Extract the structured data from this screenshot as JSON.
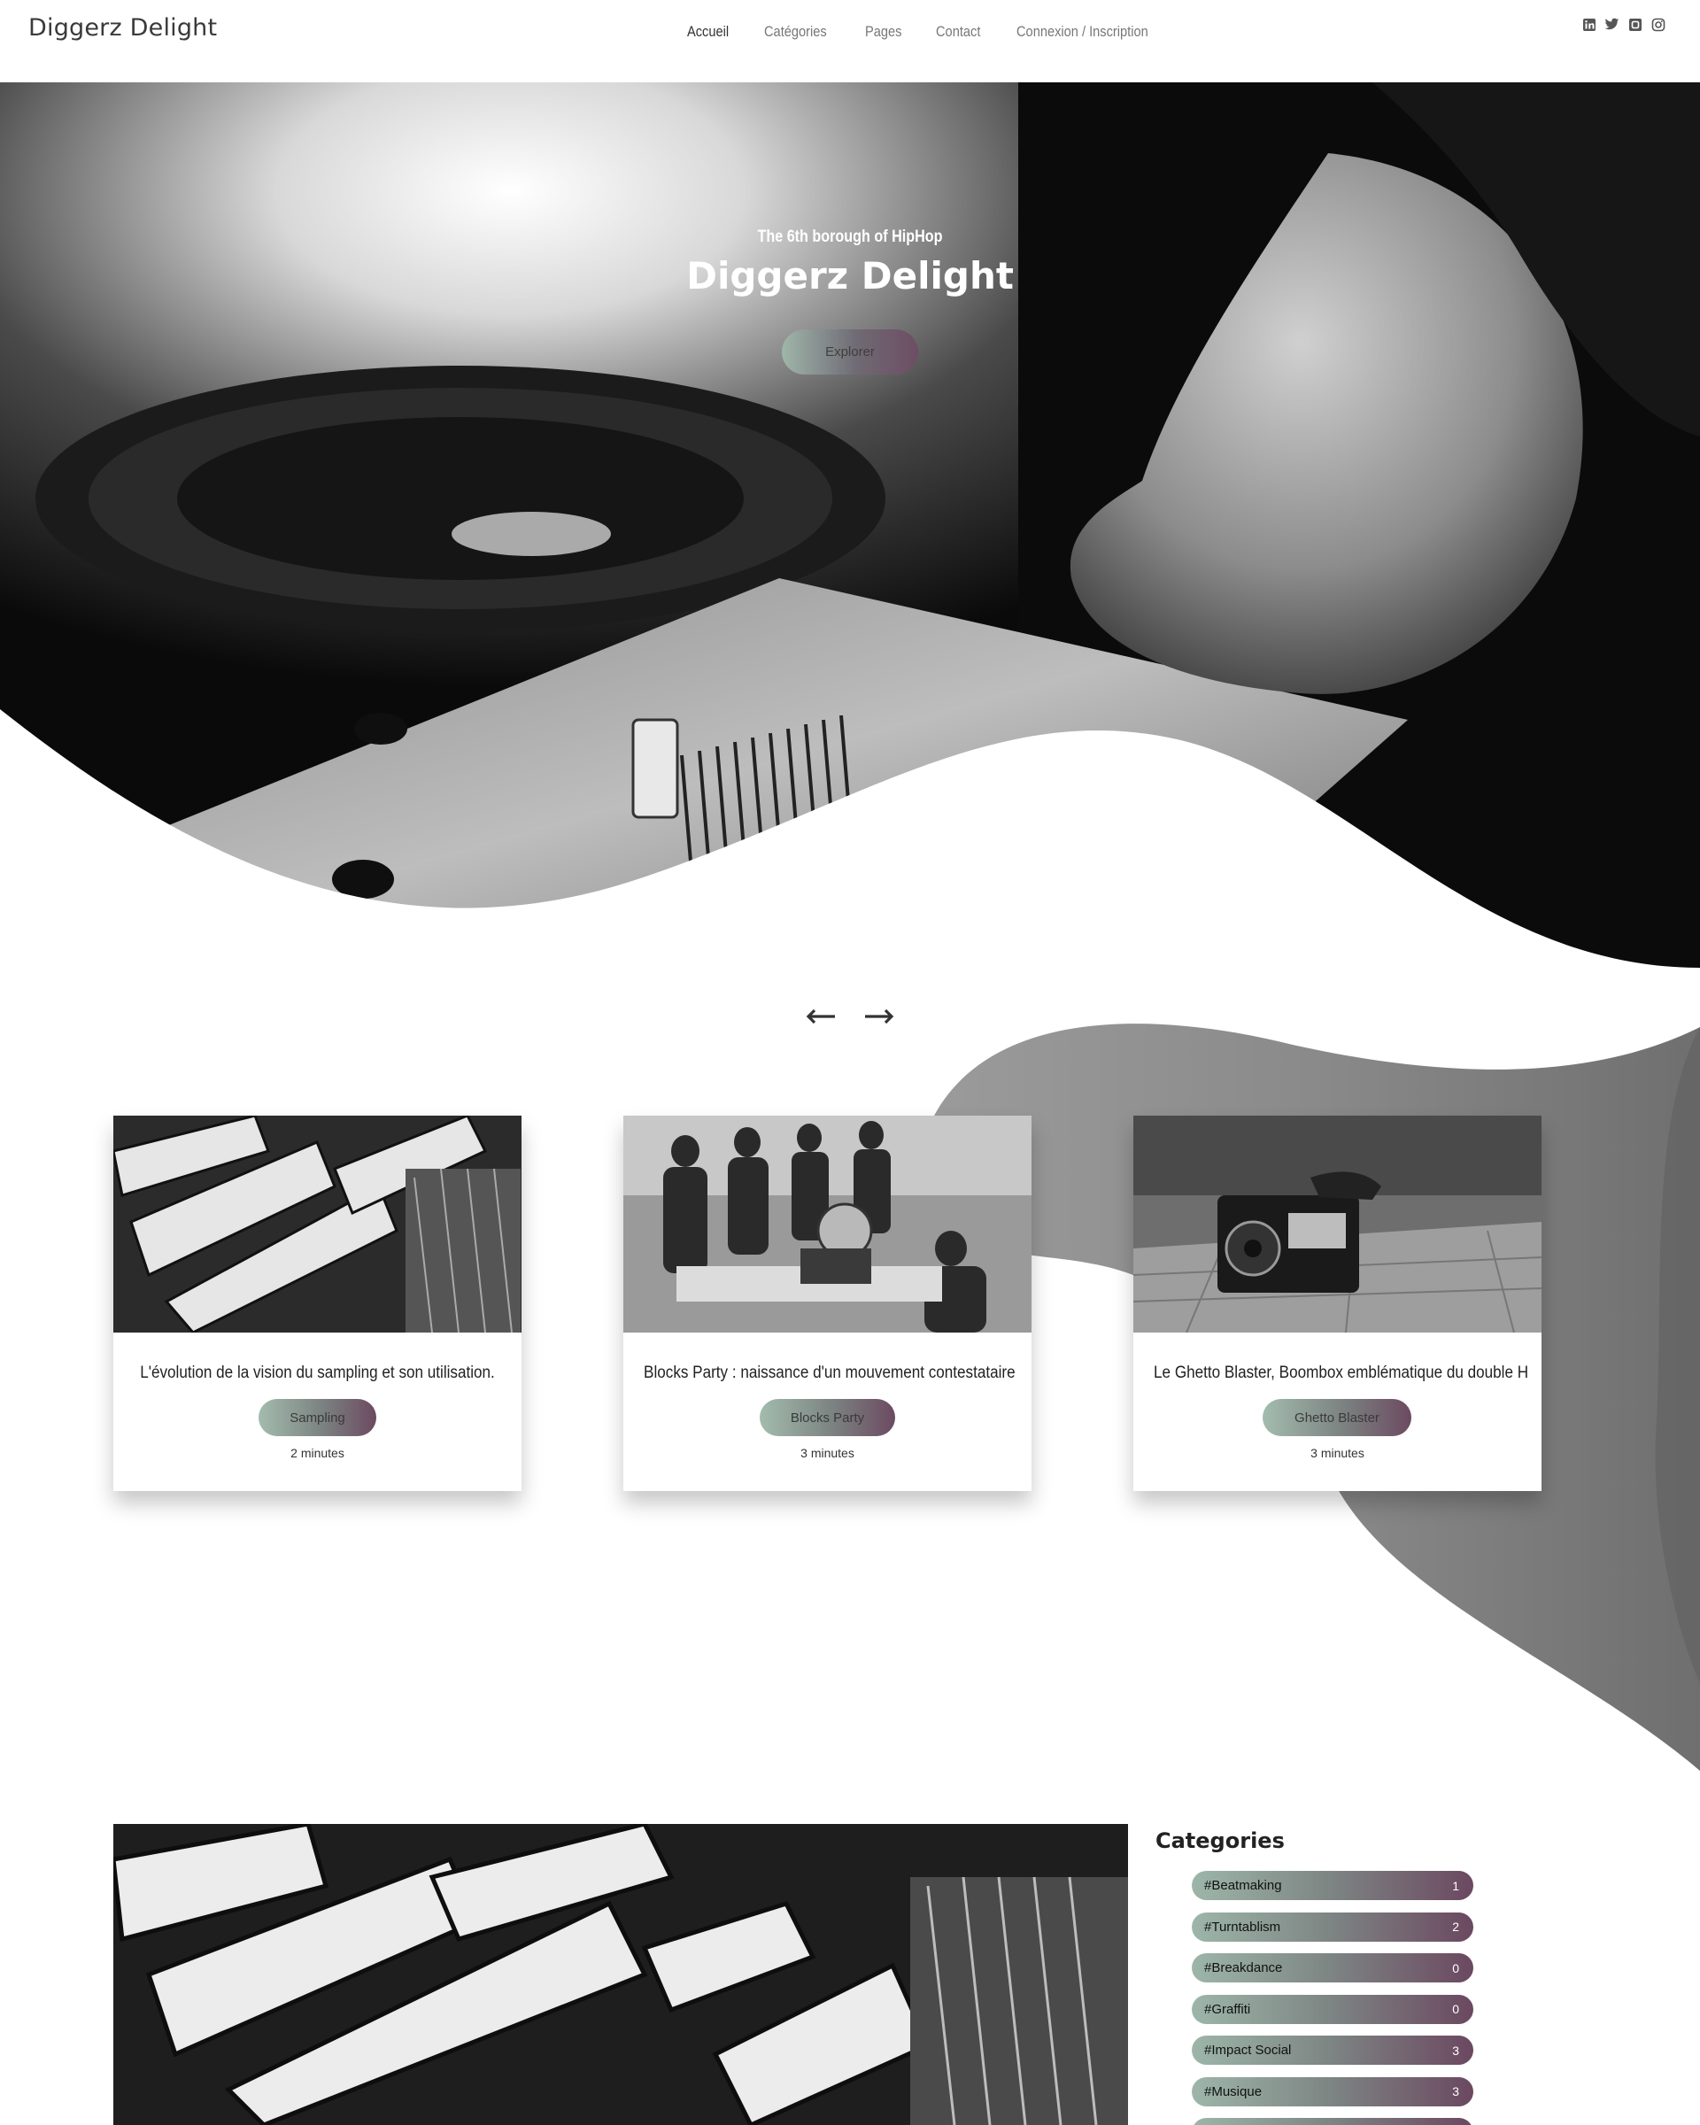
{
  "header": {
    "logo": "Diggerz Delight",
    "nav": [
      "Accueil",
      "Catégories",
      "Pages",
      "Contact",
      "Connexion / Inscription"
    ],
    "socials": [
      "linkedin-icon",
      "twitter-icon",
      "facebook-square-icon",
      "instagram-icon"
    ]
  },
  "hero": {
    "tagline": "The 6th borough of HipHop",
    "title": "Diggerz Delight",
    "button": "Explorer"
  },
  "slider": {
    "prev_icon": "arrow-left-icon",
    "next_icon": "arrow-right-icon"
  },
  "cards": [
    {
      "title": "L'évolution de la vision du sampling et son utilisation.",
      "tag": "Sampling",
      "time": "2 minutes"
    },
    {
      "title": "Blocks Party : naissance d'un mouvement contestataire",
      "tag": "Blocks Party",
      "time": "3 minutes"
    },
    {
      "title": "Le Ghetto Blaster, Boombox emblématique du double H",
      "tag": "Ghetto Blaster",
      "time": "3 minutes"
    }
  ],
  "categories": {
    "title": "Categories",
    "items": [
      {
        "label": "#Beatmaking",
        "count": "1"
      },
      {
        "label": "#Turntablism",
        "count": "2"
      },
      {
        "label": "#Breakdance",
        "count": "0"
      },
      {
        "label": "#Graffiti",
        "count": "0"
      },
      {
        "label": "#Impact Social",
        "count": "3"
      },
      {
        "label": "#Musique",
        "count": "3"
      },
      {
        "label": "",
        "count": ""
      }
    ]
  },
  "colors": {
    "pill_start": "#a3bcae",
    "pill_end": "#6c4a61",
    "nav_text": "#777777"
  }
}
